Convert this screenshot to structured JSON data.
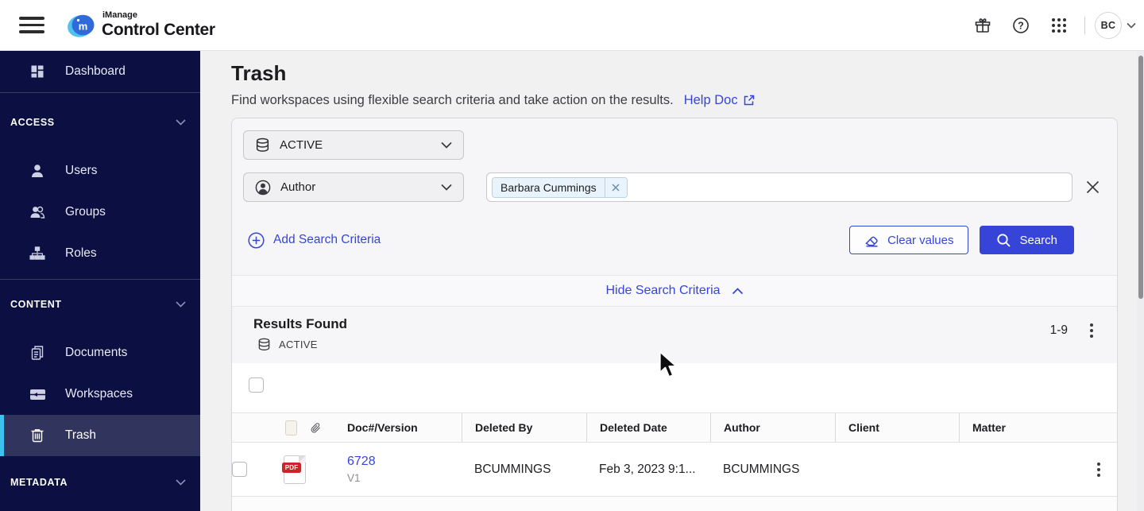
{
  "topbar": {
    "brand_small": "iManage",
    "brand_large": "Control Center",
    "avatar_initials": "BC"
  },
  "sidebar": {
    "dashboard": "Dashboard",
    "access_section": "ACCESS",
    "users": "Users",
    "groups": "Groups",
    "roles": "Roles",
    "content_section": "CONTENT",
    "documents": "Documents",
    "workspaces": "Workspaces",
    "trash": "Trash",
    "metadata_section": "METADATA"
  },
  "page": {
    "title": "Trash",
    "subtitle": "Find workspaces using flexible search criteria and take action on the results.",
    "help_link_label": "Help Doc"
  },
  "search": {
    "scope_selected": "ACTIVE",
    "field_selected": "Author",
    "value_chip": "Barbara Cummings",
    "add_criteria_label": "Add Search Criteria",
    "clear_values_label": "Clear values",
    "search_button_label": "Search",
    "hide_criteria_label": "Hide Search Criteria"
  },
  "results": {
    "title": "Results Found",
    "scope_label": "ACTIVE",
    "range_label": "1-9",
    "columns": [
      "Doc#/Version",
      "Deleted By",
      "Deleted Date",
      "Author",
      "Client",
      "Matter"
    ],
    "rows": [
      {
        "file_type": "PDF",
        "doc_number": "6728",
        "version": "V1",
        "deleted_by": "BCUMMINGS",
        "deleted_date": "Feb 3, 2023 9:1...",
        "author": "BCUMMINGS",
        "client": "",
        "matter": ""
      }
    ]
  },
  "colors": {
    "accent_blue": "#3645d8",
    "sidebar_navy": "#0b0f42",
    "selected_item_bg": "#31345c",
    "selected_accent_cyan": "#3cc1f0",
    "chip_bg": "#e9f3fb",
    "pdf_red": "#c62828"
  }
}
